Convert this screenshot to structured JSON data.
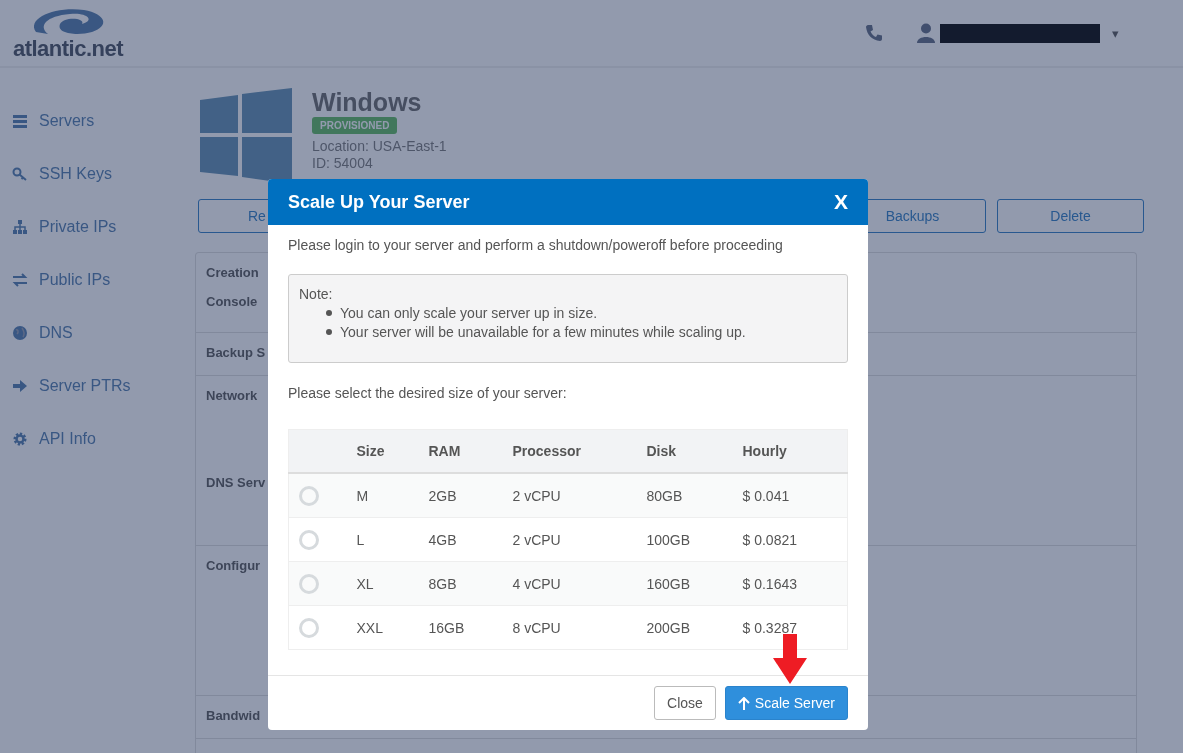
{
  "header": {
    "logo_text": "atlantic.net",
    "user_caret": "▾"
  },
  "sidebar": {
    "items": [
      {
        "label": "Servers",
        "kind": "servers"
      },
      {
        "label": "SSH Keys",
        "kind": "key"
      },
      {
        "label": "Private IPs",
        "kind": "network"
      },
      {
        "label": "Public IPs",
        "kind": "exchange"
      },
      {
        "label": "DNS",
        "kind": "globe"
      },
      {
        "label": "Server PTRs",
        "kind": "arrow"
      },
      {
        "label": "API Info",
        "kind": "gear"
      }
    ]
  },
  "server": {
    "name": "Windows",
    "status": "PROVISIONED",
    "location": "Location: USA-East-1",
    "id": "ID: 54004"
  },
  "actions": [
    "Re",
    "Backups",
    "Delete"
  ],
  "details": {
    "sections": [
      {
        "labels": [
          "Creation",
          "Console"
        ]
      },
      {
        "labels": [
          "Backup S"
        ]
      },
      {
        "labels": [
          "Network",
          "DNS Serv"
        ]
      },
      {
        "labels": [
          "Configur"
        ]
      },
      {
        "labels": [
          "Bandwid"
        ]
      }
    ]
  },
  "modal": {
    "title": "Scale Up Your Server",
    "close": "X",
    "intro": "Please login to your server and perform a shutdown/poweroff before proceeding",
    "note": {
      "label": "Note:",
      "items": [
        "You can only scale your server up in size.",
        "Your server will be unavailable for a few minutes while scaling up."
      ]
    },
    "prompt": "Please select the desired size of your server:",
    "table": {
      "columns": [
        "Size",
        "RAM",
        "Processor",
        "Disk",
        "Hourly"
      ],
      "rows": [
        {
          "selected": false,
          "cells": [
            "M",
            "2GB",
            "2 vCPU",
            "80GB",
            "$ 0.041"
          ]
        },
        {
          "selected": false,
          "cells": [
            "L",
            "4GB",
            "2 vCPU",
            "100GB",
            "$ 0.0821"
          ]
        },
        {
          "selected": false,
          "cells": [
            "XL",
            "8GB",
            "4 vCPU",
            "160GB",
            "$ 0.1643"
          ]
        },
        {
          "selected": false,
          "cells": [
            "XXL",
            "16GB",
            "8 vCPU",
            "200GB",
            "$ 0.3287"
          ]
        }
      ]
    },
    "buttons": [
      {
        "label": "Close",
        "kind": "secondary"
      },
      {
        "label": "Scale Server",
        "kind": "primary"
      }
    ]
  }
}
